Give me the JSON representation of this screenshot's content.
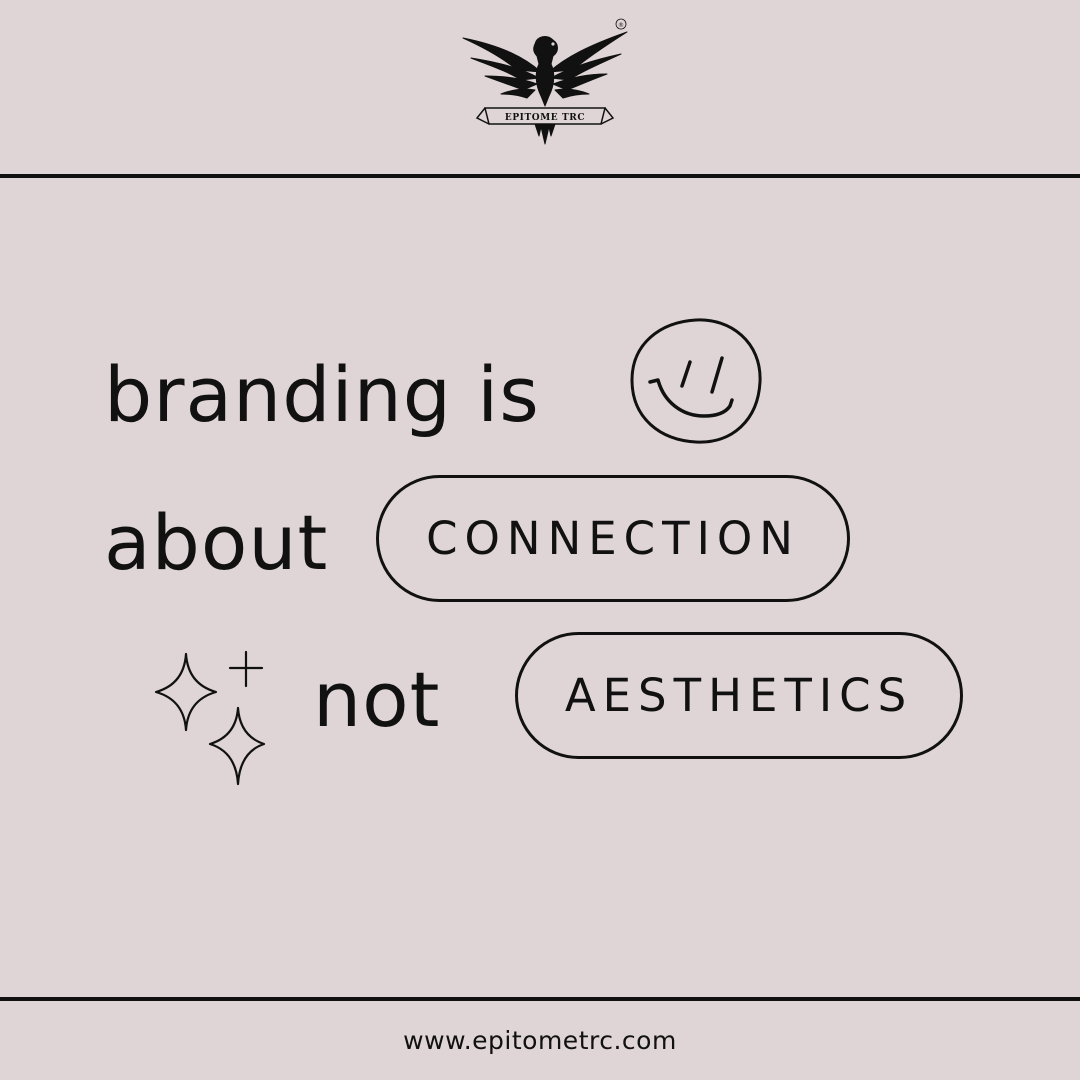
{
  "logo": {
    "brand_text": "EPITOME TRC",
    "icon": "eagle-emblem-icon",
    "registered_mark": "®"
  },
  "headline": {
    "line1": "branding is",
    "line2": "about",
    "line3": "not"
  },
  "pills": {
    "connection": "CONNECTION",
    "aesthetics": "AESTHETICS"
  },
  "decorations": {
    "smiley": "smiley-face-icon",
    "sparkles": "sparkles-icon"
  },
  "footer": {
    "website": "www.epitometrc.com"
  },
  "colors": {
    "background": "#dfd5d6",
    "ink": "#111111"
  }
}
